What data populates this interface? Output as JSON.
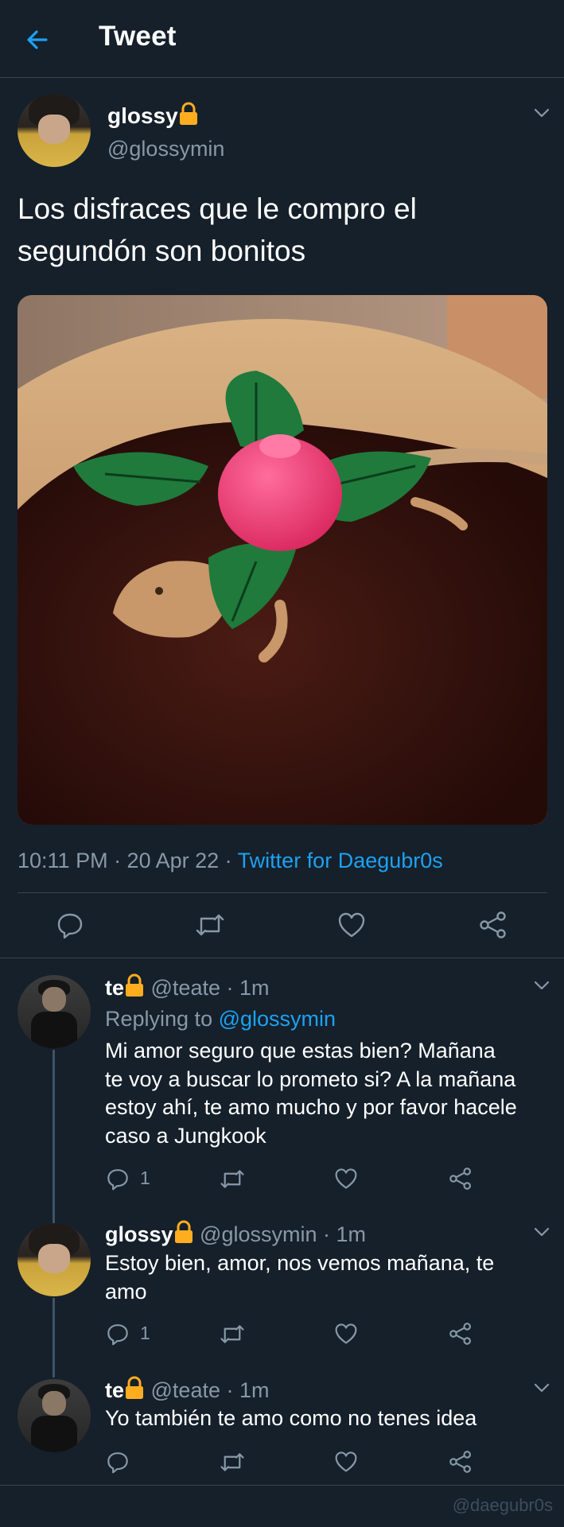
{
  "header": {
    "title": "Tweet"
  },
  "main_tweet": {
    "name": "glossy",
    "handle": "@glossymin",
    "text_line1": "Los disfraces que le compro el",
    "text_line2": "segundón son bonitos",
    "time": "10:11 PM · 20 Apr 22 · ",
    "source": "Twitter for Daegubr0s"
  },
  "replies": [
    {
      "name": "te",
      "handle_time": " @teate · 1m",
      "replying_prefix": "Replying to ",
      "replying_to": "@glossymin",
      "lines": [
        "Mi amor seguro que estas bien? Mañana",
        "te voy a buscar lo prometo si? A la mañana",
        "estoy ahí, te amo mucho y por favor hacele",
        "caso a Jungkook"
      ],
      "reply_count": "1"
    },
    {
      "name": "glossy",
      "handle_time": " @glossymin · 1m",
      "lines": [
        "Estoy bien, amor, nos vemos mañana, te",
        "amo"
      ],
      "reply_count": "1"
    },
    {
      "name": "te",
      "handle_time": " @teate · 1m",
      "lines": [
        "Yo también te amo como no tenes idea"
      ],
      "reply_count": ""
    }
  ],
  "watermark": "@daegubr0s",
  "icons": [
    "back-arrow-icon",
    "lock-icon",
    "chevron-down-icon",
    "reply-icon",
    "retweet-icon",
    "like-icon",
    "share-icon"
  ],
  "colors": {
    "background": "#15202b",
    "accent": "#1da1f2",
    "muted": "#8899a6",
    "lock": "#ffad1f"
  }
}
